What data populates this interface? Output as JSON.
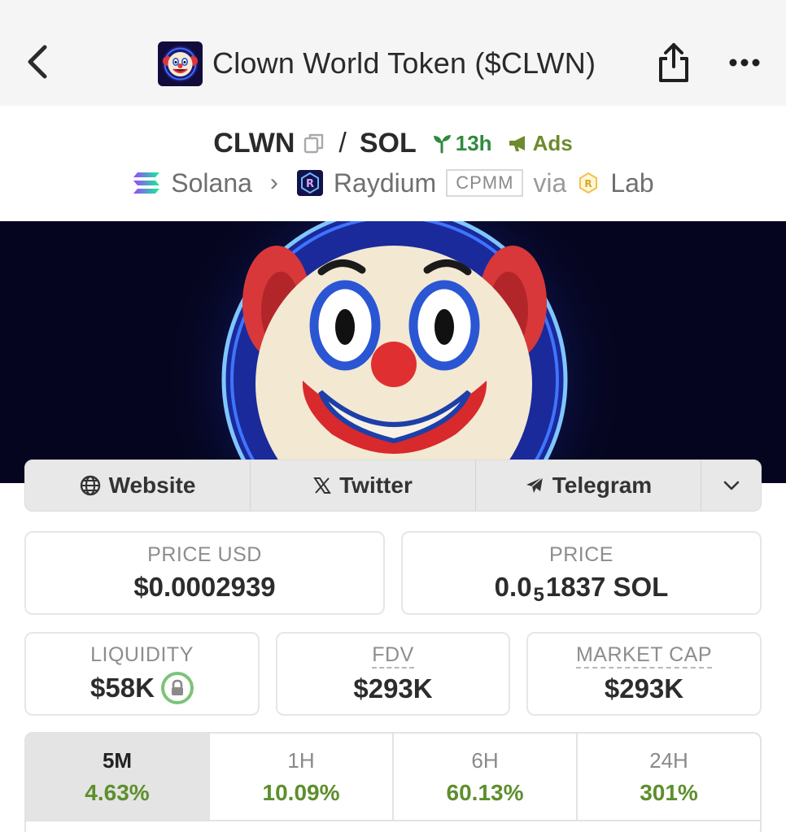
{
  "header": {
    "title": "Clown World Token ($CLWN)",
    "icons": {
      "back": "chevron-left-icon",
      "share": "share-icon",
      "more": "more-horizontal-icon"
    }
  },
  "pair": {
    "base": "CLWN",
    "separator": "/",
    "quote": "SOL",
    "age": "13h",
    "ads": "Ads",
    "colors": {
      "age": "#2f8a3e",
      "ads": "#6e8a2e"
    }
  },
  "chain": {
    "network": "Solana",
    "dex": "Raydium",
    "pool_type": "CPMM",
    "via": "via",
    "launchpad": "Lab"
  },
  "socials": {
    "website": "Website",
    "twitter": "Twitter",
    "telegram": "Telegram"
  },
  "stats": {
    "price_usd": {
      "label": "PRICE USD",
      "value": "$0.0002939"
    },
    "price_native": {
      "label": "PRICE",
      "prefix": "0.0",
      "zeros": "5",
      "suffix": "1837 SOL"
    },
    "liquidity": {
      "label": "LIQUIDITY",
      "value": "$58K"
    },
    "fdv": {
      "label": "FDV",
      "value": "$293K"
    },
    "market_cap": {
      "label": "MARKET CAP",
      "value": "$293K"
    }
  },
  "timeframes": [
    {
      "label": "5M",
      "change": "4.63%",
      "active": true
    },
    {
      "label": "1H",
      "change": "10.09%",
      "active": false
    },
    {
      "label": "6H",
      "change": "60.13%",
      "active": false
    },
    {
      "label": "24H",
      "change": "301%",
      "active": false
    }
  ],
  "colors": {
    "positive": "#5d8f2d",
    "banner_bg": "#05051f"
  }
}
